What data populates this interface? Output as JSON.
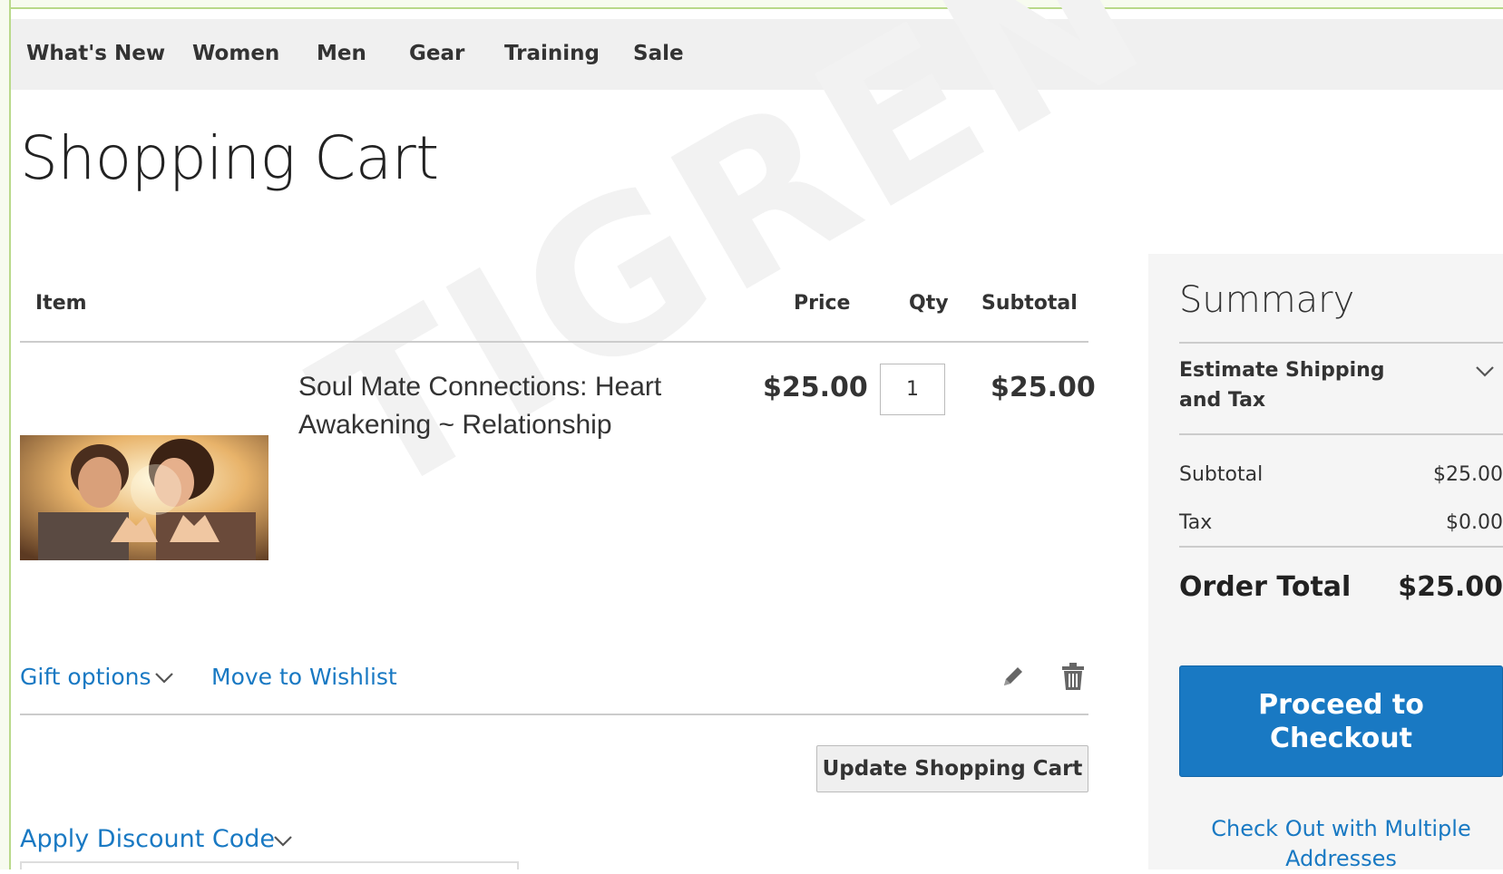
{
  "nav": {
    "items": [
      "What's New",
      "Women",
      "Men",
      "Gear",
      "Training",
      "Sale"
    ]
  },
  "page": {
    "title": "Shopping Cart",
    "watermark": "TIGREN"
  },
  "cart": {
    "headers": {
      "item": "Item",
      "price": "Price",
      "qty": "Qty",
      "subtotal": "Subtotal"
    },
    "items": [
      {
        "name": "Soul Mate Connections: Heart Awakening ~ Relationship",
        "price": "$25.00",
        "qty": "1",
        "subtotal": "$25.00",
        "image_icon": "couple-heart-hands-photo"
      }
    ],
    "actions": {
      "gift_options": "Gift options",
      "move_to_wishlist": "Move to Wishlist",
      "edit_icon": "pencil-icon",
      "delete_icon": "trash-icon"
    },
    "update_button": "Update Shopping Cart",
    "discount_label": "Apply Discount Code"
  },
  "summary": {
    "title": "Summary",
    "estimate_label": "Estimate Shipping and Tax",
    "subtotal_label": "Subtotal",
    "subtotal_value": "$25.00",
    "tax_label": "Tax",
    "tax_value": "$0.00",
    "order_total_label": "Order Total",
    "order_total_value": "$25.00",
    "checkout_button": "Proceed to Checkout",
    "multi_address_link": "Check Out with Multiple Addresses"
  },
  "colors": {
    "accent": "#1979c3",
    "nav_bg": "#f0f0f0",
    "summary_bg": "#f5f5f5"
  }
}
